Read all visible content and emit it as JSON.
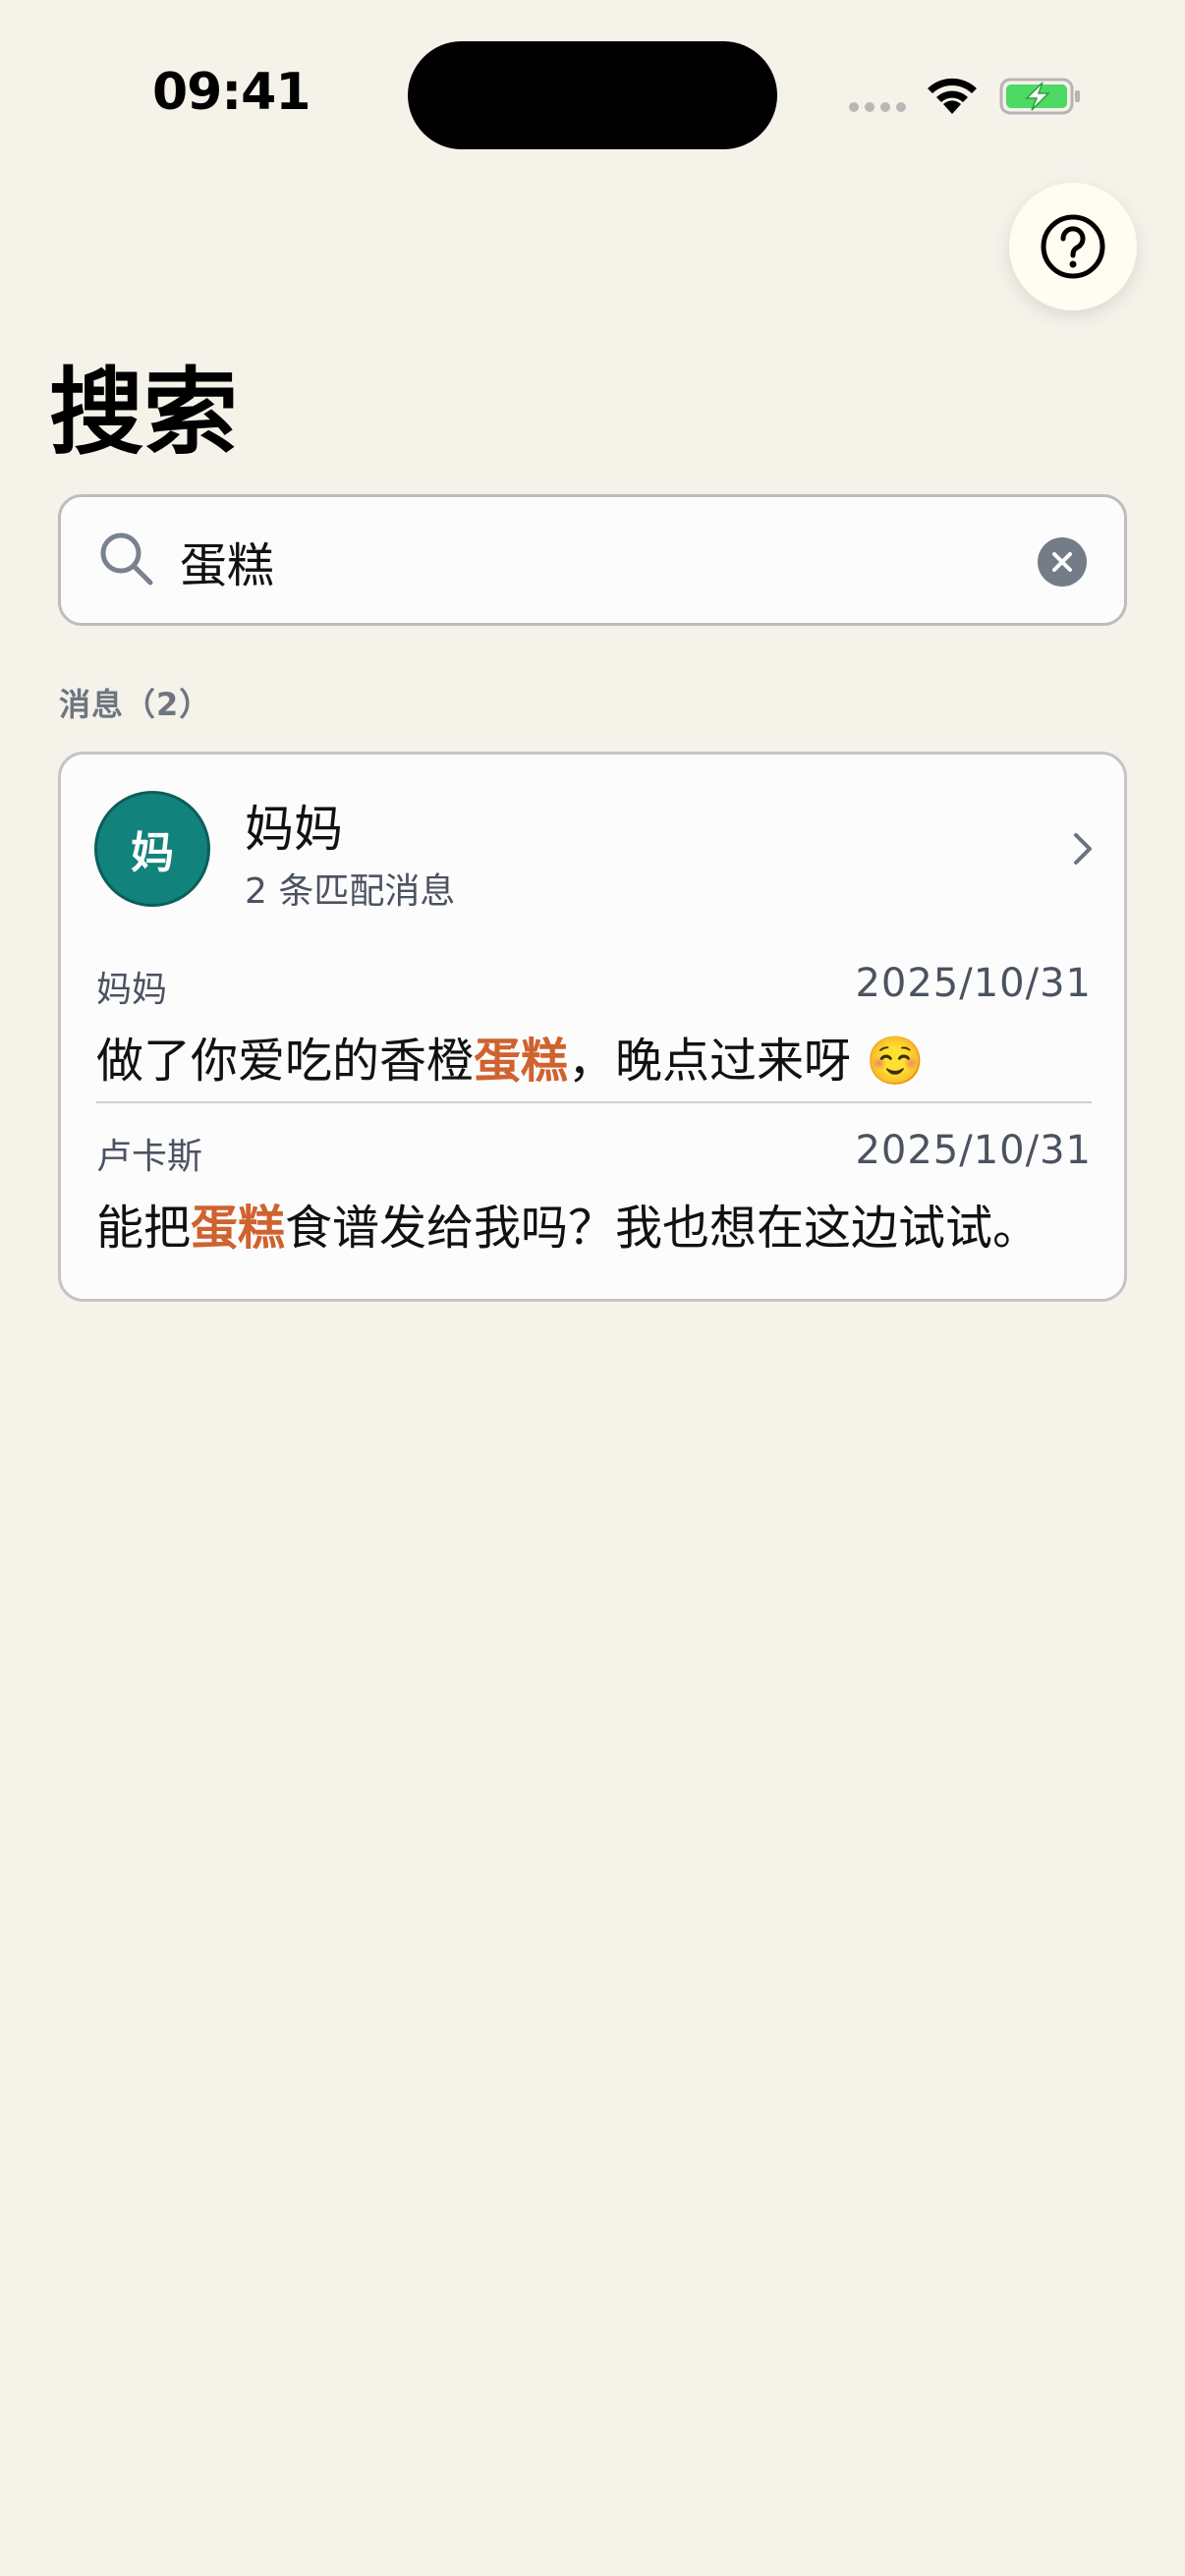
{
  "status_bar": {
    "time": "09:41"
  },
  "header": {
    "title": "搜索"
  },
  "search": {
    "value": "蛋糕"
  },
  "results": {
    "section_label": "消息（2）",
    "group": {
      "avatar_text": "妈",
      "avatar_color": "#12827C",
      "contact_name": "妈妈",
      "match_count": "2 条匹配消息",
      "messages": [
        {
          "sender": "妈妈",
          "date": "2025/10/31",
          "before": "做了你爱吃的香橙",
          "highlight": "蛋糕",
          "after": "，晚点过来呀 ☺️"
        },
        {
          "sender": "卢卡斯",
          "date": "2025/10/31",
          "before": "能把",
          "highlight": "蛋糕",
          "after": "食谱发给我吗？我也想在这边试试。"
        }
      ]
    }
  },
  "colors": {
    "background": "#F5F2EA",
    "highlight": "#D0622F",
    "battery_green": "#4CD964"
  },
  "icons": [
    "help-icon",
    "search-icon",
    "clear-icon",
    "chevron-right-icon",
    "wifi-icon",
    "battery-charging-icon",
    "signal-icon"
  ]
}
